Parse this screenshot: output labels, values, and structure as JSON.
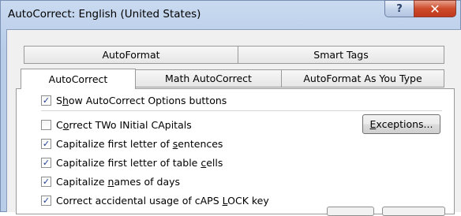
{
  "window": {
    "title": "AutoCorrect: English (United States)",
    "help_glyph": "?",
    "close_glyph": "✕"
  },
  "tabs": {
    "back_row": [
      {
        "label": "AutoFormat"
      },
      {
        "label": "Smart Tags"
      }
    ],
    "front_row": [
      {
        "label": "AutoCorrect",
        "active": true
      },
      {
        "label": "Math AutoCorrect",
        "active": false
      },
      {
        "label": "AutoFormat As You Type",
        "active": false
      }
    ]
  },
  "options": {
    "show_buttons": {
      "checked": true,
      "pre": "S",
      "acc": "h",
      "post": "ow AutoCorrect Options buttons"
    },
    "two_initial": {
      "checked": false,
      "pre": "C",
      "acc": "o",
      "post": "rrect TWo INitial CApitals"
    },
    "first_sentence": {
      "checked": true,
      "pre": "Capitalize first letter of ",
      "acc": "s",
      "post": "entences"
    },
    "first_table": {
      "checked": true,
      "pre": "Capitalize first letter of table ",
      "acc": "c",
      "post": "ells"
    },
    "names_days": {
      "checked": true,
      "pre": "Capitalize ",
      "acc": "n",
      "post": "ames of days"
    },
    "caps_lock": {
      "checked": true,
      "pre": "Correct accidental usage of cAPS ",
      "acc": "L",
      "post": "OCK key"
    }
  },
  "exceptions_button": {
    "acc": "E",
    "post": "xceptions..."
  },
  "checkmark_glyph": "✓"
}
